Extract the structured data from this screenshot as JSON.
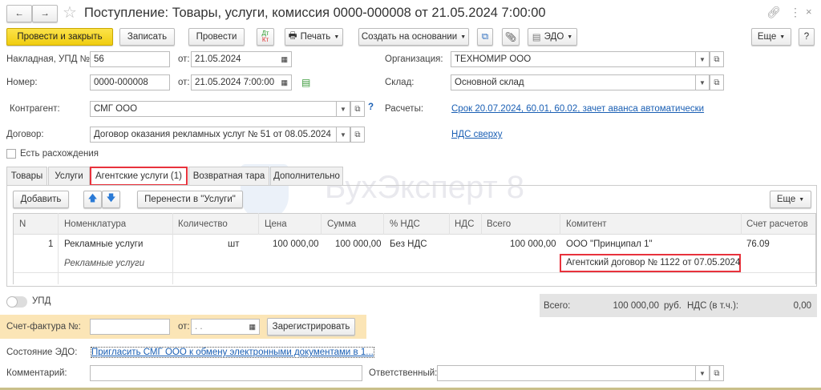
{
  "window": {
    "title": "Поступление: Товары, услуги, комиссия 0000-000008 от 21.05.2024 7:00:00"
  },
  "toolbar": {
    "post_close": "Провести и закрыть",
    "save": "Записать",
    "post": "Провести",
    "dtkt_top": "Дт",
    "dtkt_bottom": "Кт",
    "print": "Печать",
    "create_based": "Создать на основании",
    "edo": "ЭДО",
    "more": "Еще",
    "help": "?"
  },
  "header": {
    "invoice_label": "Накладная, УПД №:",
    "invoice_value": "56",
    "from_label": "от:",
    "invoice_date": "21.05.2024",
    "number_label": "Номер:",
    "number_value": "0000-000008",
    "number_date": "21.05.2024  7:00:00",
    "counterparty_label": "Контрагент:",
    "counterparty_value": "СМГ ООО",
    "help": "?",
    "contract_label": "Договор:",
    "contract_value": "Договор оказания рекламных услуг № 51 от 08.05.2024",
    "discrepancy_label": "Есть расхождения",
    "org_label": "Организация:",
    "org_value": "ТЕХНОМИР ООО",
    "warehouse_label": "Склад:",
    "warehouse_value": "Основной склад",
    "settlements_label": "Расчеты:",
    "settlements_link": "Срок 20.07.2024, 60.01, 60.02, зачет аванса автоматически",
    "vat_link": "НДС сверху"
  },
  "tabs": [
    "Товары",
    "Услуги",
    "Агентские услуги (1)",
    "Возвратная тара",
    "Дополнительно"
  ],
  "watermark": "БухЭксперт 8",
  "table_toolbar": {
    "add": "Добавить",
    "move": "Перенести в \"Услуги\"",
    "more": "Еще"
  },
  "table": {
    "headers": [
      "N",
      "Номенклатура",
      "Количество",
      "Цена",
      "Сумма",
      "% НДС",
      "НДС",
      "Всего",
      "Комитент",
      "Счет расчетов"
    ],
    "rows": [
      {
        "n": "1",
        "item": "Рекламные услуги",
        "item_sub": "Рекламные услуги",
        "unit": "шт",
        "price": "100 000,00",
        "sum": "100 000,00",
        "vat_rate": "Без НДС",
        "vat": "",
        "total": "100 000,00",
        "principal": "ООО \"Принципал 1\"",
        "principal_contract": "Агентский договор № 1122 от 07.05.2024",
        "account": "76.09"
      }
    ]
  },
  "footer": {
    "upd_label": "УПД",
    "total_label": "Всего:",
    "total_value": "100 000,00",
    "currency": "руб.",
    "vat_label": "НДС (в т.ч.):",
    "vat_value": "0,00",
    "sf_label": "Счет-фактура №:",
    "sf_from": "от:",
    "sf_date": " .  .",
    "register": "Зарегистрировать",
    "edo_label": "Состояние ЭДО:",
    "edo_link": "Пригласить СМГ ООО к обмену электронными документами в 1...",
    "comment_label": "Комментарий:",
    "responsible_label": "Ответственный:"
  },
  "colors": {
    "accent_yellow": "#f5d61b",
    "highlight": "#e8323c",
    "link": "#1a5fb4"
  }
}
